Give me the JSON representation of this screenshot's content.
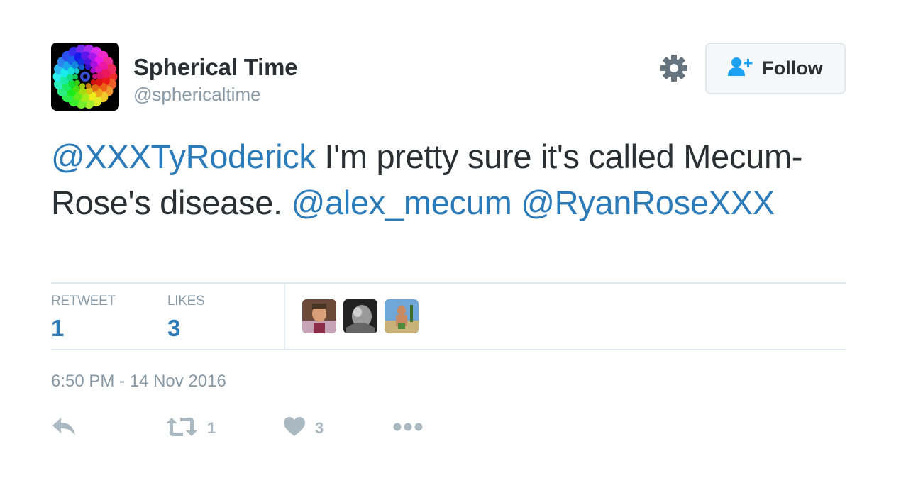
{
  "author": {
    "display_name": "Spherical Time",
    "handle": "@sphericaltime",
    "avatar_icon": "rainbow-spheres-avatar"
  },
  "header": {
    "settings_icon": "gear-icon",
    "follow_label": "Follow",
    "follow_icon": "add-user-icon"
  },
  "tweet": {
    "segments": [
      {
        "text": "@XXXTyRoderick",
        "type": "mention"
      },
      {
        "text": " I'm pretty sure it's called Mecum-Rose's disease. ",
        "type": "text"
      },
      {
        "text": "@alex_mecum",
        "type": "mention"
      },
      {
        "text": " ",
        "type": "text"
      },
      {
        "text": "@RyanRoseXXX",
        "type": "mention"
      }
    ]
  },
  "stats": {
    "retweet_label": "RETWEET",
    "retweet_count": "1",
    "likes_label": "LIKES",
    "likes_count": "3",
    "likers": [
      "liker-avatar-1",
      "liker-avatar-2",
      "liker-avatar-3"
    ]
  },
  "timestamp": "6:50 PM - 14 Nov 2016",
  "actions": {
    "reply_icon": "reply-icon",
    "retweet_icon": "retweet-icon",
    "retweet_count": "1",
    "like_icon": "heart-icon",
    "like_count": "3",
    "more_icon": "more-icon"
  },
  "colors": {
    "link": "#2b7bb9",
    "text": "#292f33",
    "muted": "#8899a6",
    "action_gray": "#aab8c2",
    "border": "#e1e8ed",
    "follow_icon": "#1da1f2"
  }
}
